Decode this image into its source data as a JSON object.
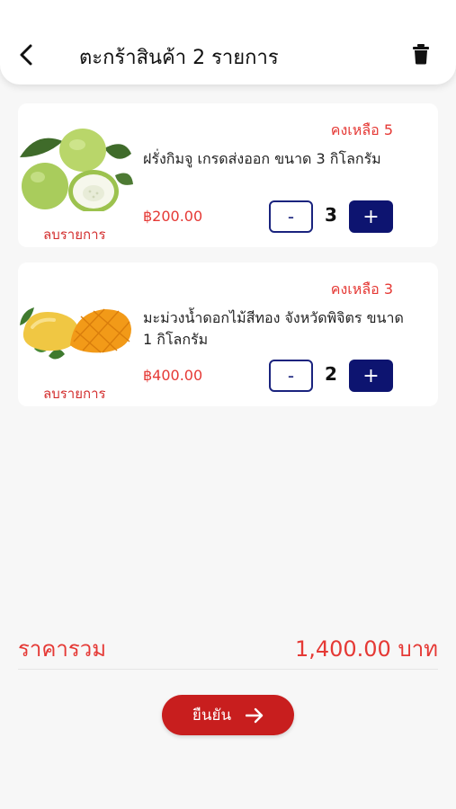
{
  "header": {
    "title": "ตะกร้าสินค้า 2 รายการ",
    "back_icon": "chevron-left-icon",
    "trash_icon": "trash-icon"
  },
  "cart_items": [
    {
      "stock_label": "คงเหลือ 5",
      "name": "ฝรั่งกิมจู เกรดส่งออก ขนาด 3 กิโลกรัม",
      "price": "฿200.00",
      "quantity": "3",
      "minus_label": "-",
      "plus_label": "+",
      "remove_label": "ลบรายการ",
      "image": "guava-image"
    },
    {
      "stock_label": "คงเหลือ 3",
      "name": "มะม่วงน้ำดอกไม้สีทอง จังหวัดพิจิตร ขนาด 1 กิโลกรัม",
      "price": "฿400.00",
      "quantity": "2",
      "minus_label": "-",
      "plus_label": "+",
      "remove_label": "ลบรายการ",
      "image": "mango-image"
    }
  ],
  "summary": {
    "total_label": "ราคารวม",
    "total_value": "1,400.00 บาท"
  },
  "confirm": {
    "label": "ยืนยัน",
    "icon": "arrow-right-icon"
  },
  "colors": {
    "accent_red": "#e53935",
    "button_red": "#c81e1e",
    "navy": "#0d1470",
    "background": "#f7f7f7"
  }
}
